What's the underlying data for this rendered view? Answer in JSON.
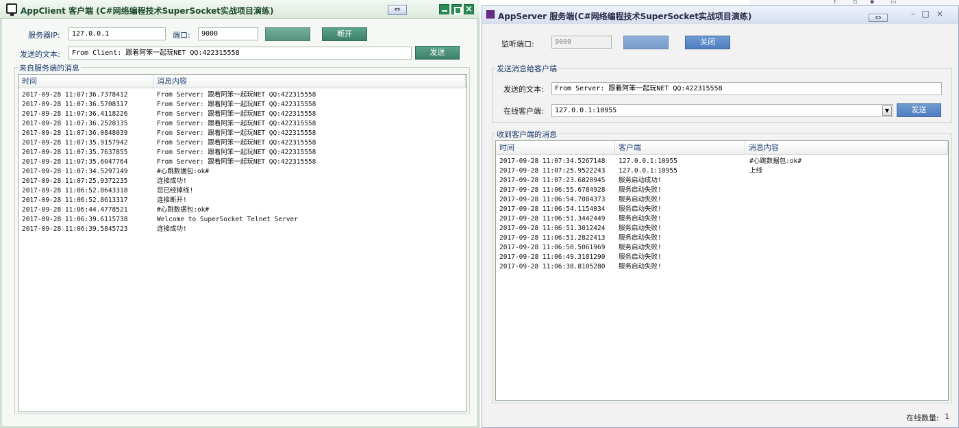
{
  "client": {
    "title": "AppClient 客户端 (C#网络编程技术SuperSocket实战项目演练)",
    "restore_glyph": "⇔",
    "server_ip_label": "服务器IP:",
    "server_ip_value": "127.0.0.1",
    "port_label": "端口:",
    "port_value": "9000",
    "connect_label": "",
    "disconnect_label": "断开",
    "send_text_label": "发送的文本:",
    "send_text_value": "From Client: 跟着阿笨一起玩NET QQ:422315558",
    "send_label": "发送",
    "group_title": "来自服务端的消息",
    "columns": [
      "时间",
      "消息内容"
    ],
    "rows": [
      [
        "2017-09-28 11:07:36.7378412",
        "From Server: 跟着阿笨一起玩NET QQ:422315558"
      ],
      [
        "2017-09-28 11:07:36.5708317",
        "From Server: 跟着阿笨一起玩NET QQ:422315558"
      ],
      [
        "2017-09-28 11:07:36.4118226",
        "From Server: 跟着阿笨一起玩NET QQ:422315558"
      ],
      [
        "2017-09-28 11:07:36.2528135",
        "From Server: 跟着阿笨一起玩NET QQ:422315558"
      ],
      [
        "2017-09-28 11:07:36.0848039",
        "From Server: 跟着阿笨一起玩NET QQ:422315558"
      ],
      [
        "2017-09-28 11:07:35.9157942",
        "From Server: 跟着阿笨一起玩NET QQ:422315558"
      ],
      [
        "2017-09-28 11:07:35.7637855",
        "From Server: 跟着阿笨一起玩NET QQ:422315558"
      ],
      [
        "2017-09-28 11:07:35.6047764",
        "From Server: 跟着阿笨一起玩NET QQ:422315558"
      ],
      [
        "2017-09-28 11:07:34.5297149",
        "#心跳数据包:ok#"
      ],
      [
        "2017-09-28 11:07:25.9372235",
        "连接成功!"
      ],
      [
        "2017-09-28 11:06:52.8643318",
        "您已经掉线!"
      ],
      [
        "2017-09-28 11:06:52.8613317",
        "连接断开!"
      ],
      [
        "2017-09-28 11:06:44.4778521",
        "#心跳数据包:ok#"
      ],
      [
        "2017-09-28 11:06:39.6115738",
        "Welcome to SuperSocket Telnet Server"
      ],
      [
        "2017-09-28 11:06:39.5845723",
        "连接成功!"
      ]
    ]
  },
  "server": {
    "title": "AppServer 服务端(C#网络编程技术SuperSocket实战项目演练)",
    "restore_glyph": "⇔",
    "listen_port_label": "监听端口:",
    "listen_port_value": "9000",
    "start_label": "",
    "close_label": "关闭",
    "send_group_title": "发送消息给客户端",
    "send_text_label": "发送的文本:",
    "send_text_value": "From Server: 跟着阿笨一起玩NET QQ:422315558",
    "online_clients_label": "在线客户端:",
    "online_clients_value": "127.0.0.1:10955",
    "send_label": "发送",
    "recv_group_title": "收到客户端的消息",
    "columns": [
      "时间",
      "客户端",
      "消息内容"
    ],
    "rows": [
      [
        "2017-09-28 11:07:34.5267148",
        "127.0.0.1:10955",
        "#心跳数据包:ok#"
      ],
      [
        "2017-09-28 11:07:25.9522243",
        "127.0.0.1:10955",
        "上线"
      ],
      [
        "2017-09-28 11:07:23.6820945",
        "服务启动成功!",
        ""
      ],
      [
        "2017-09-28 11:06:55.6784928",
        "服务启动失败!",
        ""
      ],
      [
        "2017-09-28 11:06:54.7084373",
        "服务启动失败!",
        ""
      ],
      [
        "2017-09-28 11:06:54.1154034",
        "服务启动失败!",
        ""
      ],
      [
        "2017-09-28 11:06:51.3442449",
        "服务启动失败!",
        ""
      ],
      [
        "2017-09-28 11:06:51.3012424",
        "服务启动失败!",
        ""
      ],
      [
        "2017-09-28 11:06:51.2822413",
        "服务启动失败!",
        ""
      ],
      [
        "2017-09-28 11:06:50.5061969",
        "服务启动失败!",
        ""
      ],
      [
        "2017-09-28 11:06:49.3181290",
        "服务启动失败!",
        ""
      ],
      [
        "2017-09-28 11:06:38.8105280",
        "服务启动失败!",
        ""
      ]
    ],
    "online_count_label": "在线数量:",
    "online_count_value": "1"
  }
}
